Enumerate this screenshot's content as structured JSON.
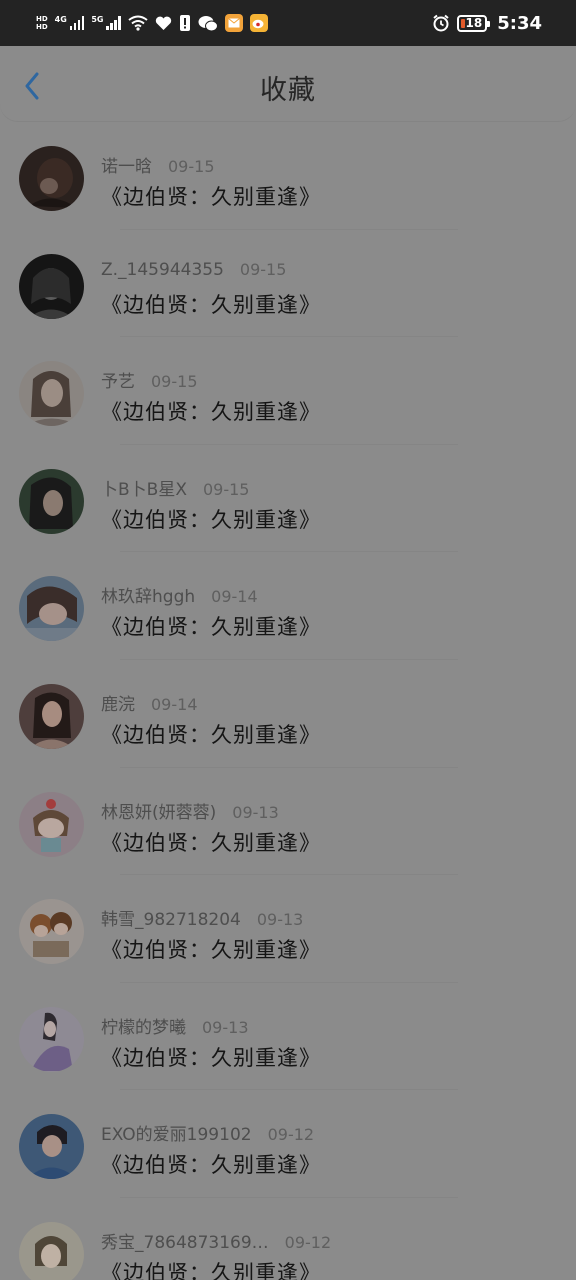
{
  "status_bar": {
    "network": "4G",
    "network2": "5G",
    "battery": "18",
    "time": "5:34"
  },
  "header": {
    "title": "收藏"
  },
  "items": [
    {
      "user": "诺一晗",
      "date": "09-15",
      "title": "《边伯贤：久别重逢》"
    },
    {
      "user": "Z._145944355",
      "date": "09-15",
      "title": "《边伯贤：久别重逢》"
    },
    {
      "user": "予艺",
      "date": "09-15",
      "title": "《边伯贤：久别重逢》"
    },
    {
      "user": "卜B卜B星X",
      "date": "09-15",
      "title": "《边伯贤：久别重逢》"
    },
    {
      "user": "林玖辞hggh",
      "date": "09-14",
      "title": "《边伯贤：久别重逢》"
    },
    {
      "user": "鹿浣",
      "date": "09-14",
      "title": "《边伯贤：久别重逢》"
    },
    {
      "user": "林恩妍(妍蓉蓉)",
      "date": "09-13",
      "title": "《边伯贤：久别重逢》"
    },
    {
      "user": "韩雪_982718204",
      "date": "09-13",
      "title": "《边伯贤：久别重逢》"
    },
    {
      "user": "柠檬的梦曦",
      "date": "09-13",
      "title": "《边伯贤：久别重逢》"
    },
    {
      "user": "EXO的爱丽199102",
      "date": "09-12",
      "title": "《边伯贤：久别重逢》"
    },
    {
      "user": "秀宝_7864873169…",
      "date": "09-12",
      "title": "《边伯贤：久别重逢》"
    }
  ]
}
